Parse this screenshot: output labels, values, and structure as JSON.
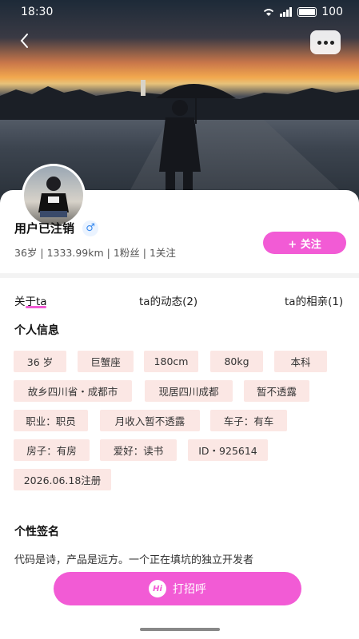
{
  "status_bar": {
    "time": "18:30",
    "battery": "100"
  },
  "profile": {
    "name": "用户已注销",
    "gender_icon": "male-icon",
    "meta": "36岁 | 1333.99km | 1粉丝 | 1关注",
    "follow_label": "+ 关注"
  },
  "tabs": [
    {
      "label": "关于ta"
    },
    {
      "label": "ta的动态(2)"
    },
    {
      "label": "ta的相亲(1)"
    }
  ],
  "personal_info": {
    "title": "个人信息",
    "tags": [
      "36 岁",
      "巨蟹座",
      "180cm",
      "80kg",
      "本科",
      "故乡四川省・成都市",
      "现居四川成都",
      "暂不透露",
      "职业：职员",
      "月收入暂不透露",
      "车子：有车",
      "房子：有房",
      "爱好：读书",
      "ID・925614",
      "2026.06.18注册"
    ]
  },
  "signature": {
    "title": "个性签名",
    "text": "代码是诗，产品是远方。一个正在填坑的独立开发者"
  },
  "greet_button": {
    "icon_text": "Hi",
    "label": "打招呼"
  },
  "colors": {
    "accent": "#f25bd5",
    "tag_bg": "#fbe7e4",
    "gender_blue": "#3a8bef"
  }
}
